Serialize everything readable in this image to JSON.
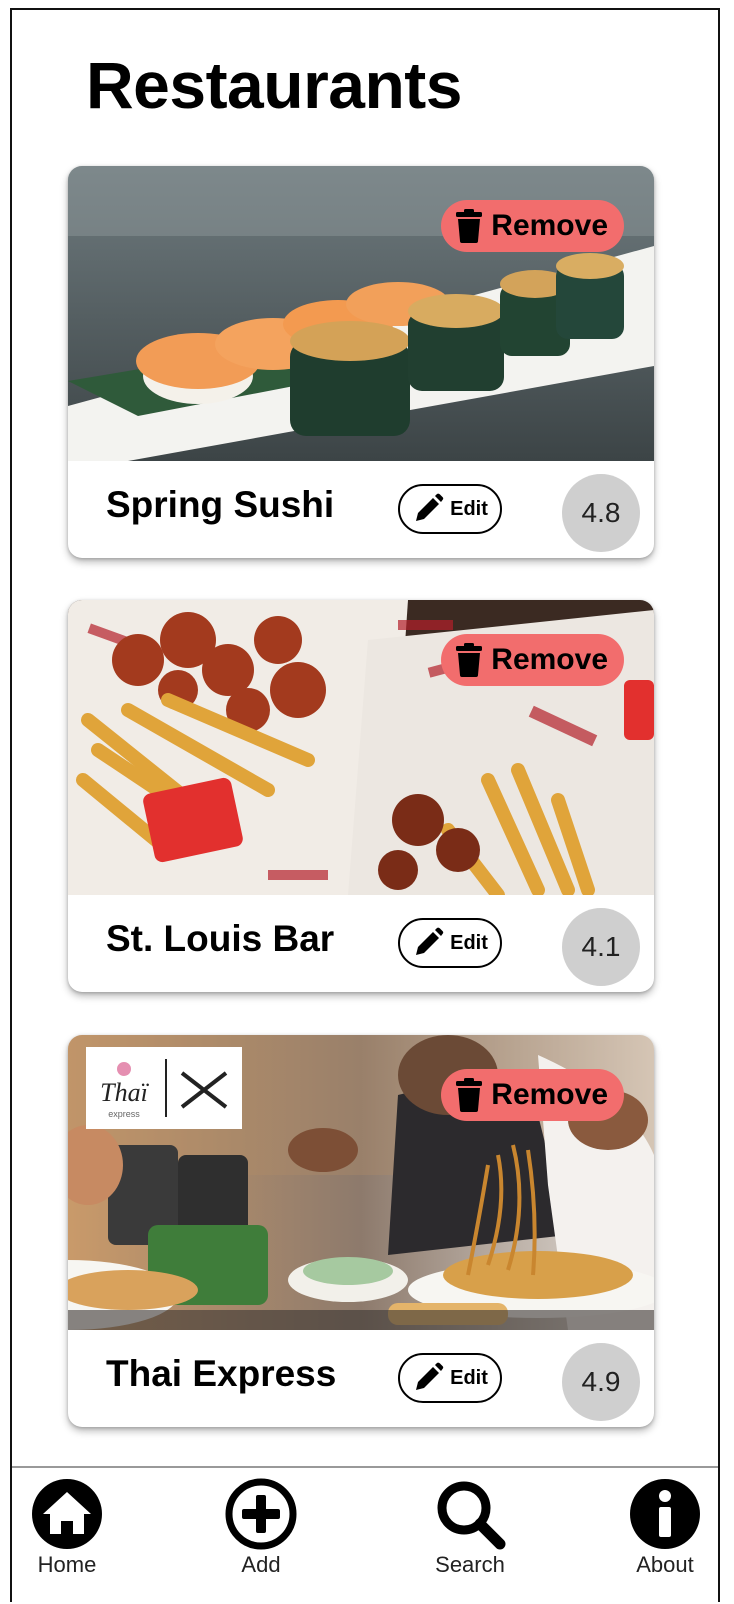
{
  "header": {
    "title": "Restaurants"
  },
  "restaurants": [
    {
      "name": "Spring Sushi",
      "rating": "4.8",
      "remove_label": "Remove",
      "edit_label": "Edit",
      "photo": "sushi-photo"
    },
    {
      "name": "St. Louis Bar",
      "rating": "4.1",
      "remove_label": "Remove",
      "edit_label": "Edit",
      "photo": "wings-fries-photo"
    },
    {
      "name": "Thai Express",
      "rating": "4.9",
      "remove_label": "Remove",
      "edit_label": "Edit",
      "photo": "thai-noodles-photo"
    }
  ],
  "photo_overlay": {
    "logo_text": "Thaï",
    "logo_sub": "express"
  },
  "nav": [
    {
      "label": "Home",
      "icon": "home-icon"
    },
    {
      "label": "Add",
      "icon": "add-icon"
    },
    {
      "label": "Search",
      "icon": "search-icon"
    },
    {
      "label": "About",
      "icon": "info-icon"
    }
  ],
  "colors": {
    "remove_bg": "#f26d6d",
    "rating_bg": "#cfcfcf",
    "text": "#000000"
  }
}
